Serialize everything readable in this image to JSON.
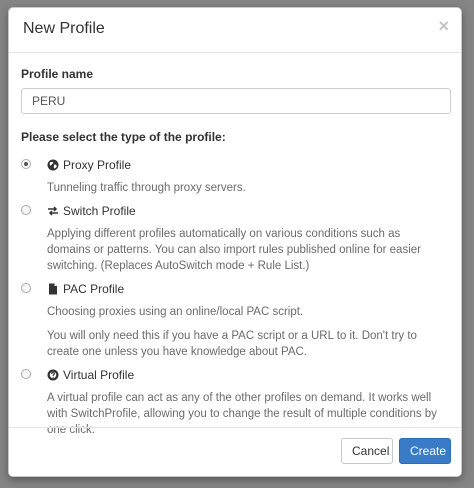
{
  "dialog": {
    "title": "New Profile",
    "close_glyph": "×"
  },
  "profile_name": {
    "label": "Profile name",
    "value": "PERU"
  },
  "type_heading": "Please select the type of the profile:",
  "options": [
    {
      "title": "Proxy Profile",
      "icon": "globe-icon",
      "checked": true,
      "desc": [
        "Tunneling traffic through proxy servers."
      ]
    },
    {
      "title": "Switch Profile",
      "icon": "switch-arrows-icon",
      "checked": false,
      "desc": [
        "Applying different profiles automatically on various conditions such as domains or patterns. You can also import rules published online for easier switching. (Replaces AutoSwitch mode + Rule List.)"
      ]
    },
    {
      "title": "PAC Profile",
      "icon": "file-icon",
      "checked": false,
      "desc": [
        "Choosing proxies using an online/local PAC script.",
        "You will only need this if you have a PAC script or a URL to it. Don't try to create one unless you have knowledge about PAC."
      ]
    },
    {
      "title": "Virtual Profile",
      "icon": "question-circle-icon",
      "checked": false,
      "desc": [
        "A virtual profile can act as any of the other profiles on demand. It works well with SwitchProfile, allowing you to change the result of multiple conditions by one click."
      ]
    }
  ],
  "footer": {
    "cancel_label": "Cancel",
    "create_label": "Create"
  },
  "colors": {
    "primary": "#3a7bc8",
    "backdrop": "rgba(0,0,0,0.45)"
  }
}
